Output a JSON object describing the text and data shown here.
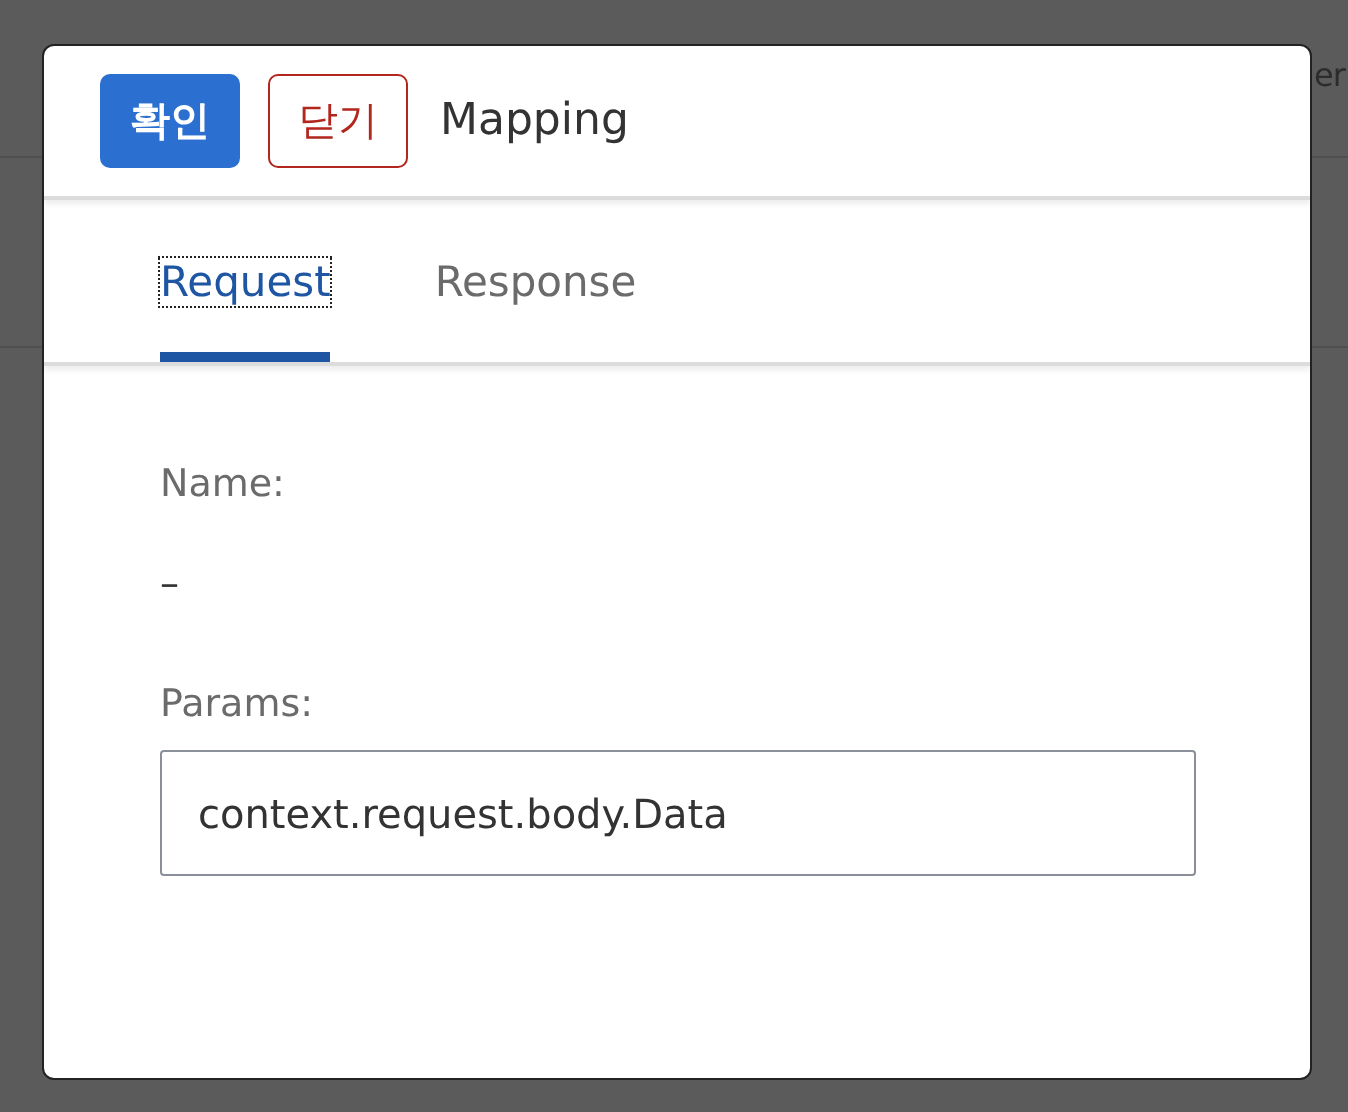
{
  "background": {
    "header_text": "er"
  },
  "dialog": {
    "buttons": [
      {
        "kind": "primary",
        "label": "확인"
      },
      {
        "kind": "danger",
        "label": "닫기"
      }
    ],
    "title": "Mapping",
    "tabs": [
      {
        "label": "Request",
        "selected": true
      },
      {
        "label": "Response",
        "selected": false
      }
    ],
    "fields": [
      {
        "kind": "text",
        "label": "Name:",
        "value": "–"
      },
      {
        "kind": "input",
        "label": "Params:",
        "value": "context.request.body.Data"
      }
    ]
  }
}
